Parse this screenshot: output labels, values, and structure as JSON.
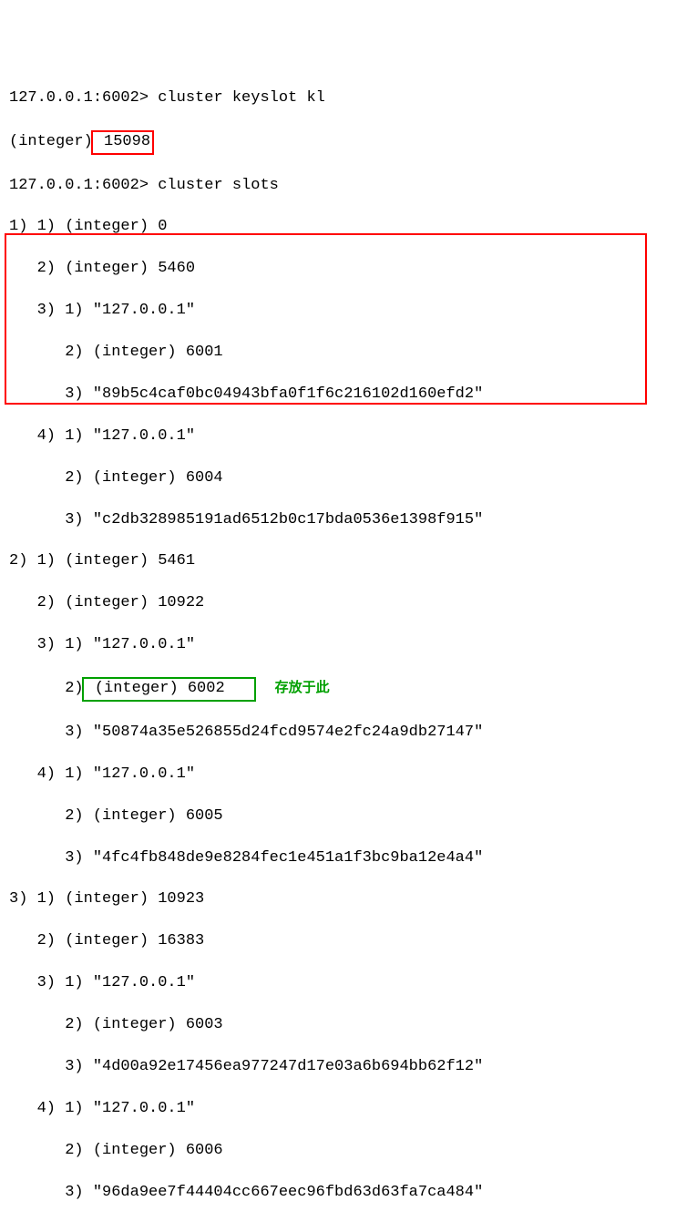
{
  "prompt1": "127.0.0.1:6002> ",
  "cmd1": "cluster keyslot kl",
  "resp1_prefix": "(integer)",
  "resp1_value": " 15098",
  "prompt2": "127.0.0.1:6002> ",
  "cmd2": "cluster slots",
  "slots": {
    "s1": {
      "l1": "1) 1) (integer) 0",
      "l2": "   2) (integer) 5460",
      "l3": "   3) 1) \"127.0.0.1\"",
      "l4": "      2) (integer) 6001",
      "l5": "      3) \"89b5c4caf0bc04943bfa0f1f6c216102d160efd2\"",
      "l6": "   4) 1) \"127.0.0.1\"",
      "l7": "      2) (integer) 6004",
      "l8": "      3) \"c2db328985191ad6512b0c17bda0536e1398f915\""
    },
    "s2": {
      "l1": "2) 1) (integer) 5461",
      "l2": "   2) (integer) 10922",
      "l3": "   3) 1) \"127.0.0.1\"",
      "l4a": "      2)",
      "l4b": " (integer) 6002   ",
      "label": "存放于此",
      "l5": "      3) \"50874a35e526855d24fcd9574e2fc24a9db27147\"",
      "l6": "   4) 1) \"127.0.0.1\"",
      "l7": "      2) (integer) 6005",
      "l8": "      3) \"4fc4fb848de9e8284fec1e451a1f3bc9ba12e4a4\""
    },
    "s3": {
      "l1": "3) 1) (integer) 10923",
      "l2": "   2) (integer) 16383",
      "l3": "   3) 1) \"127.0.0.1\"",
      "l4": "      2) (integer) 6003",
      "l5": "      3) \"4d00a92e17456ea977247d17e03a6b694bb62f12\"",
      "l6": "   4) 1) \"127.0.0.1\"",
      "l7": "      2) (integer) 6006",
      "l8": "      3) \"96da9ee7f44404cc667eec96fbd63d63fa7ca484\""
    }
  }
}
